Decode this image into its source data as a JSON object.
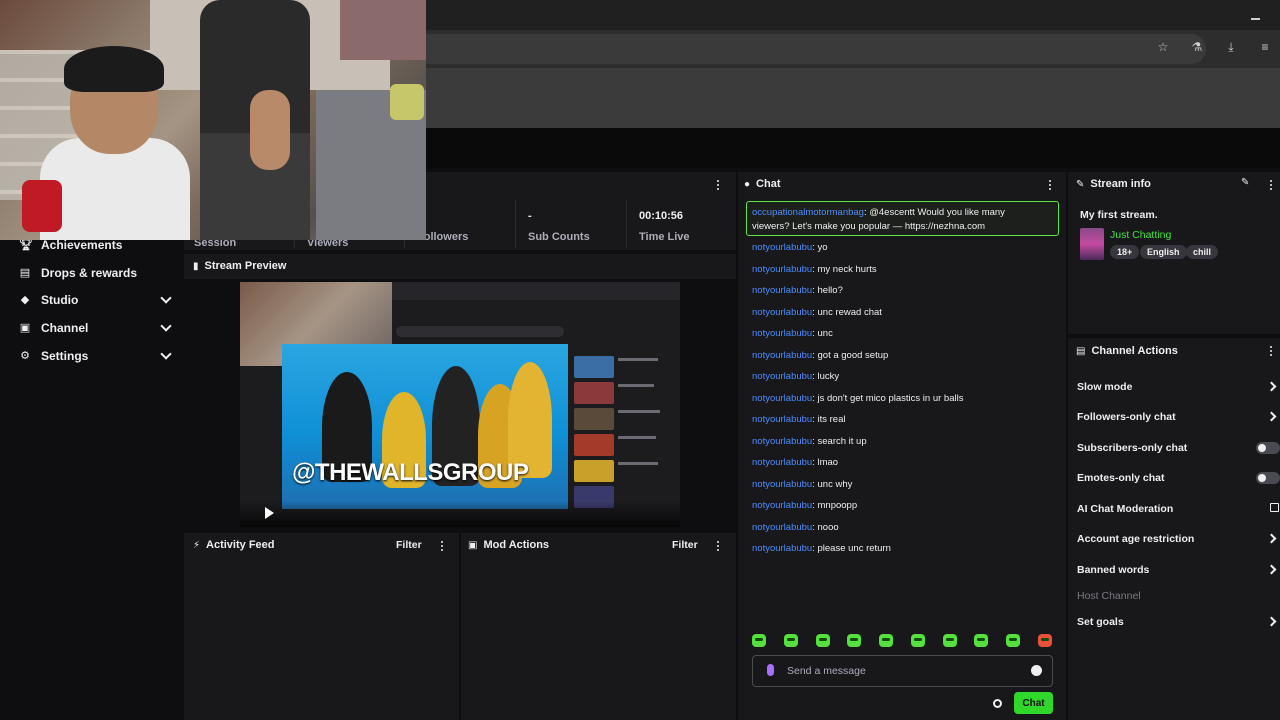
{
  "nav": {
    "items": [
      {
        "label": "Achievements",
        "icon": "trophy-icon",
        "expandable": false
      },
      {
        "label": "Drops & rewards",
        "icon": "gift-icon",
        "expandable": false
      },
      {
        "label": "Studio",
        "icon": "studio-icon",
        "expandable": true
      },
      {
        "label": "Channel",
        "icon": "channel-icon",
        "expandable": true
      },
      {
        "label": "Settings",
        "icon": "gear-icon",
        "expandable": true
      }
    ]
  },
  "stats": {
    "session_label": "Session",
    "viewers_label": "Viewers",
    "followers_label": "Followers",
    "sub_counts_value": "-",
    "sub_counts_label": "Sub Counts",
    "time_live_value": "00:10:56",
    "time_live_label": "Time Live"
  },
  "preview": {
    "title": "Stream Preview",
    "caption": "@THEWALLSGROUP"
  },
  "activity": {
    "title": "Activity Feed",
    "filter": "Filter"
  },
  "mod": {
    "title": "Mod Actions",
    "filter": "Filter"
  },
  "chat": {
    "title": "Chat",
    "highlight": {
      "user": "occupationalmotormanbag",
      "line1": ": @4escentt Would you like many",
      "line2": "viewers? Let's make you popular — https://nezhna.com"
    },
    "messages": [
      {
        "user": "notyourlabubu",
        "text": ": yo"
      },
      {
        "user": "notyourlabubu",
        "text": ": my neck hurts"
      },
      {
        "user": "notyourlabubu",
        "text": ": hello?"
      },
      {
        "user": "notyourlabubu",
        "text": ": unc rewad chat"
      },
      {
        "user": "notyourlabubu",
        "text": ": unc"
      },
      {
        "user": "notyourlabubu",
        "text": ": got a good setup"
      },
      {
        "user": "notyourlabubu",
        "text": ": lucky"
      },
      {
        "user": "notyourlabubu",
        "text": ": js don't get mico plastics in ur balls"
      },
      {
        "user": "notyourlabubu",
        "text": ": its real"
      },
      {
        "user": "notyourlabubu",
        "text": ": search it up"
      },
      {
        "user": "notyourlabubu",
        "text": ": lmao"
      },
      {
        "user": "notyourlabubu",
        "text": ": unc why"
      },
      {
        "user": "notyourlabubu",
        "text": ": mnpoopp"
      },
      {
        "user": "notyourlabubu",
        "text": ": nooo"
      },
      {
        "user": "notyourlabubu",
        "text": ": please unc return"
      }
    ],
    "input_placeholder": "Send a message",
    "send_label": "Chat"
  },
  "stream_info": {
    "title": "Stream info",
    "stream_title": "My first stream.",
    "category": "Just Chatting",
    "tags": [
      "18+",
      "English",
      "chill"
    ]
  },
  "channel_actions": {
    "title": "Channel Actions",
    "items": [
      {
        "label": "Slow mode",
        "control": "arrow"
      },
      {
        "label": "Followers-only chat",
        "control": "arrow"
      },
      {
        "label": "Subscribers-only chat",
        "control": "toggle"
      },
      {
        "label": "Emotes-only chat",
        "control": "toggle"
      },
      {
        "label": "AI Chat Moderation",
        "control": "external"
      },
      {
        "label": "Account age restriction",
        "control": "arrow"
      },
      {
        "label": "Banned words",
        "control": "arrow"
      },
      {
        "label": "Host Channel",
        "control": "none"
      },
      {
        "label": "Set goals",
        "control": "arrow"
      }
    ]
  },
  "colors": {
    "accent_green": "#2fd82a",
    "username_blue": "#4a8cff",
    "panel": "#18181b",
    "background": "#0e0e10"
  }
}
